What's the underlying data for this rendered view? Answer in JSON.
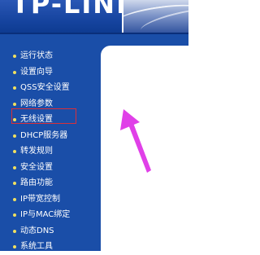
{
  "header": {
    "logo_text": "TP-LINK"
  },
  "sidebar": {
    "items": [
      {
        "label": "运行状态"
      },
      {
        "label": "设置向导"
      },
      {
        "label": "QSS安全设置"
      },
      {
        "label": "网络参数"
      },
      {
        "label": "无线设置"
      },
      {
        "label": "DHCP服务器"
      },
      {
        "label": "转发规则"
      },
      {
        "label": "安全设置"
      },
      {
        "label": "路由功能"
      },
      {
        "label": "IP带宽控制"
      },
      {
        "label": "IP与MAC绑定"
      },
      {
        "label": "动态DNS"
      },
      {
        "label": "系统工具"
      }
    ],
    "highlighted_item": "无线设置"
  },
  "annotation": {
    "arrow_color": "#e040e8",
    "box_color": "#d8303a"
  },
  "colors": {
    "sidebar_bg": "#1a4ea8",
    "header_bg": "#11409a",
    "bullet": "#f0e060",
    "content_bg": "#ffffff"
  }
}
